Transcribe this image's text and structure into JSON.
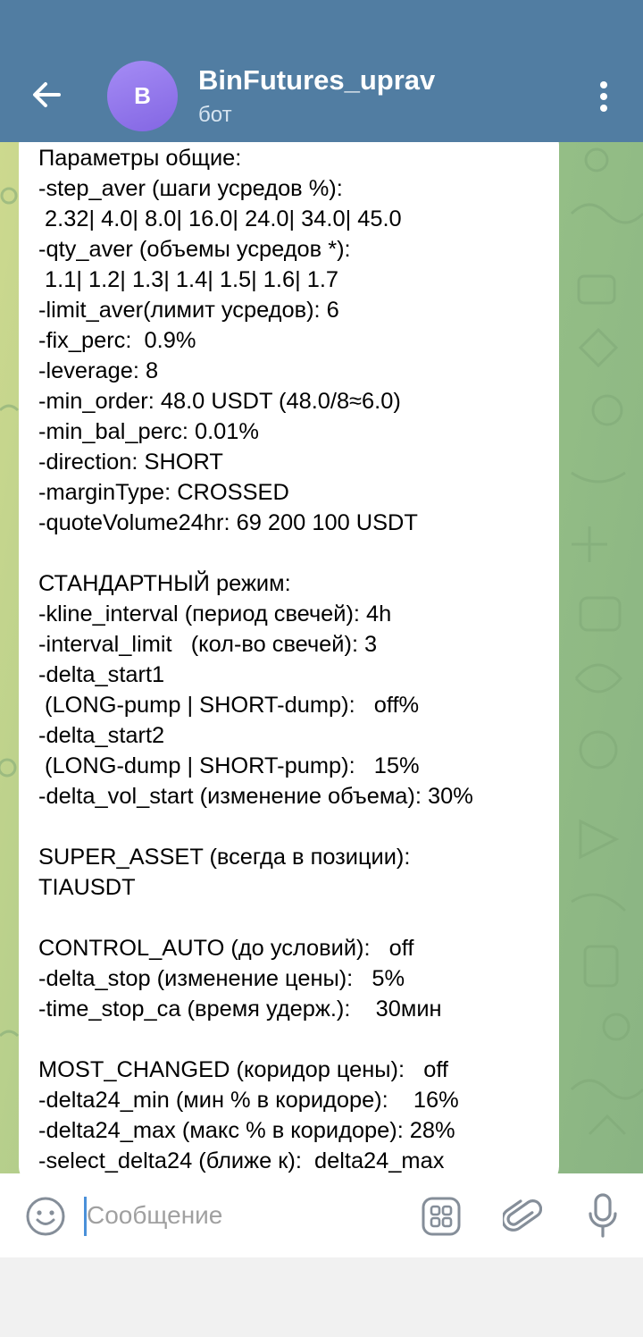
{
  "header": {
    "avatar_letter": "B",
    "title": "BinFutures_uprav",
    "subtitle": "бот",
    "back_icon": "arrow-left-icon",
    "menu_icon": "vertical-dots-icon"
  },
  "message": {
    "lines": [
      "Параметры общие:",
      "-step_aver (шаги усредов %):",
      " 2.32| 4.0| 8.0| 16.0| 24.0| 34.0| 45.0",
      "-qty_aver (объемы усредов *):",
      " 1.1| 1.2| 1.3| 1.4| 1.5| 1.6| 1.7",
      "-limit_aver(лимит усредов): 6",
      "-fix_perc:  0.9%",
      "-leverage: 8",
      "-min_order: 48.0 USDT (48.0/8≈6.0)",
      "-min_bal_perc: 0.01%",
      "-direction: SHORT",
      "-marginType: CROSSED",
      "-quoteVolume24hr: 69 200 100 USDT",
      "",
      "СТАНДАРТНЫЙ режим:",
      "-kline_interval (период свечей): 4h",
      "-interval_limit   (кол-во свечей): 3",
      "-delta_start1",
      " (LONG-pump | SHORT-dump):   off%",
      "-delta_start2",
      " (LONG-dump | SHORT-pump):   15%",
      "-delta_vol_start (изменение объема): 30%",
      "",
      "SUPER_ASSET (всегда в позиции):",
      "TIAUSDT",
      "",
      "CONTROL_AUTO (до условий):   off",
      "-delta_stop (изменение цены):   5%",
      "-time_stop_ca (время удерж.):    30мин",
      "",
      "MOST_CHANGED (коридор цены):   off",
      "-delta24_min (мин % в коридоре):    16%",
      "-delta24_max (макс % в коридоре): 28%",
      "-select_delta24 (ближе к):  delta24_max"
    ]
  },
  "composer": {
    "placeholder": "Сообщение",
    "value": "",
    "emoji_icon": "emoji-icon",
    "commands_icon": "bot-commands-icon",
    "attach_icon": "paperclip-icon",
    "mic_icon": "microphone-icon"
  },
  "colors": {
    "header": "#517da2",
    "bubble": "#ffffff",
    "chat_bg_left": "#cdd98e",
    "chat_bg_right": "#8ab483",
    "caret": "#4a90d9"
  }
}
